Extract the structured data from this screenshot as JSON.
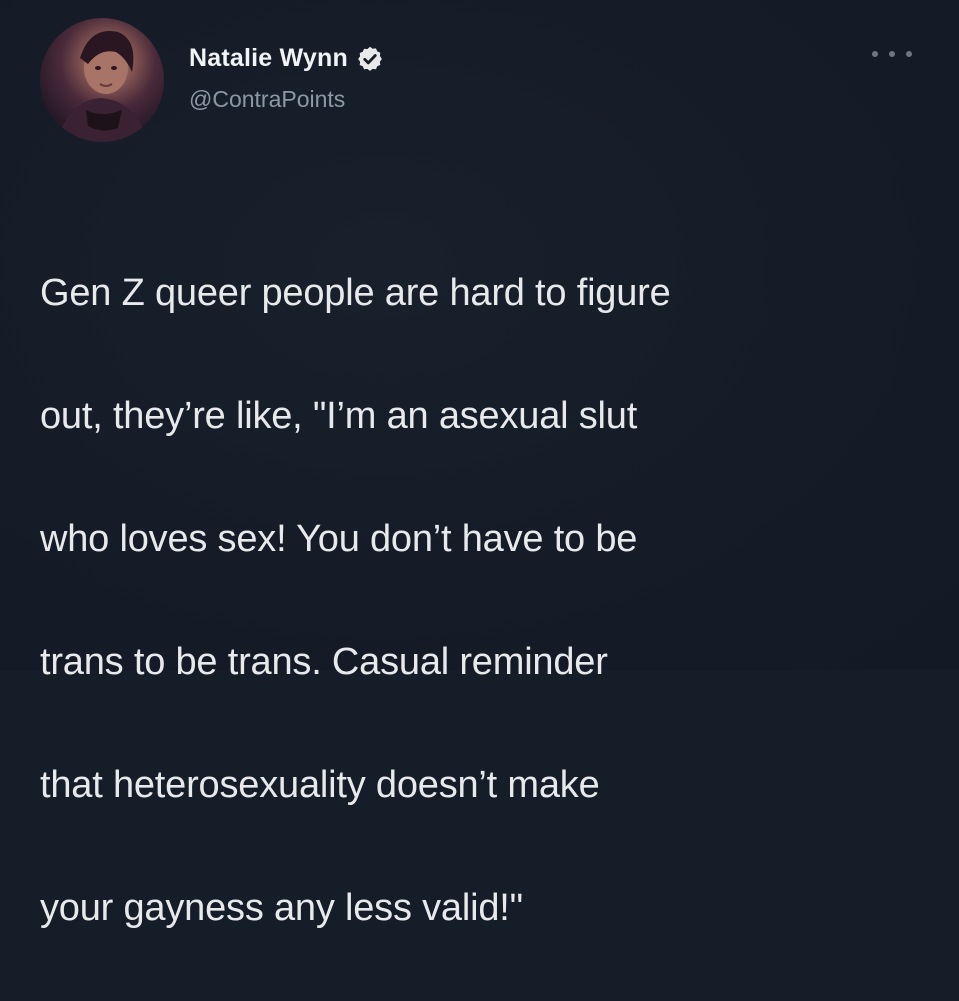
{
  "tweet": {
    "author": {
      "display_name": "Natalie Wynn",
      "handle": "@ContraPoints",
      "verified": true,
      "avatar_icon": "profile-photo"
    },
    "more_icon": "more-horizontal-icon",
    "text_lines": [
      "Gen Z queer people are hard to figure",
      "out, they’re like, \"I’m an asexual slut",
      "who loves sex! You don’t have to be",
      "trans to be trans. Casual reminder",
      "that heterosexuality doesn’t make",
      "your gayness any less valid!\""
    ]
  },
  "colors": {
    "background": "#151d29",
    "text": "#e7e9ea",
    "secondary_text": "#8b98a5",
    "verified_badge": "#e7e9ea"
  }
}
